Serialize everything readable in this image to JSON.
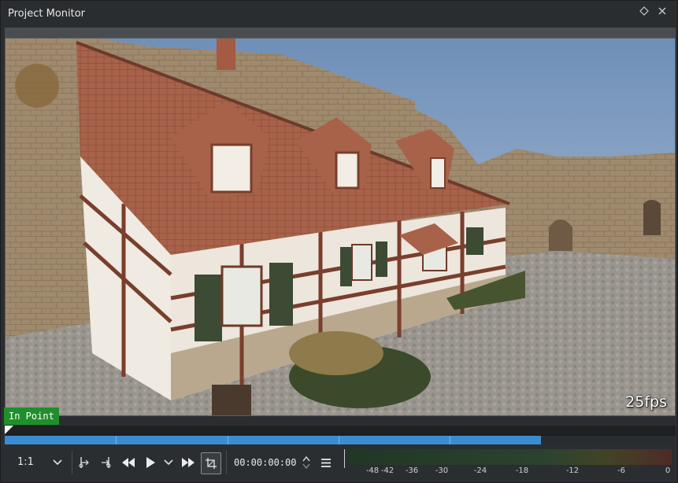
{
  "window": {
    "title": "Project Monitor"
  },
  "viewer": {
    "fps_label": "25fps",
    "in_point_label": "In Point"
  },
  "playback": {
    "progress_fraction": 0.799
  },
  "toolbar": {
    "zoom_value": "1:1",
    "timecode": "00:00:00:00"
  },
  "audio_meter": {
    "scale_labels": [
      "-48",
      "-42",
      "-36",
      "-30",
      "-24",
      "-18",
      "-12",
      "-6",
      "0"
    ]
  },
  "icons": {
    "float": "diamond-icon",
    "close": "close-icon",
    "zoom_dropdown": "chevron-down-icon",
    "set_in": "set-in-point-icon",
    "set_out": "set-out-point-icon",
    "rewind": "rewind-icon",
    "play": "play-icon",
    "play_options": "chevron-down-icon",
    "forward": "forward-icon",
    "crop": "crop-icon",
    "timecode_step": "spin-arrows-icon",
    "menu": "hamburger-menu-icon"
  },
  "colors": {
    "in_point_badge": "#1f8f2a",
    "progress": "#3a8dd1"
  }
}
